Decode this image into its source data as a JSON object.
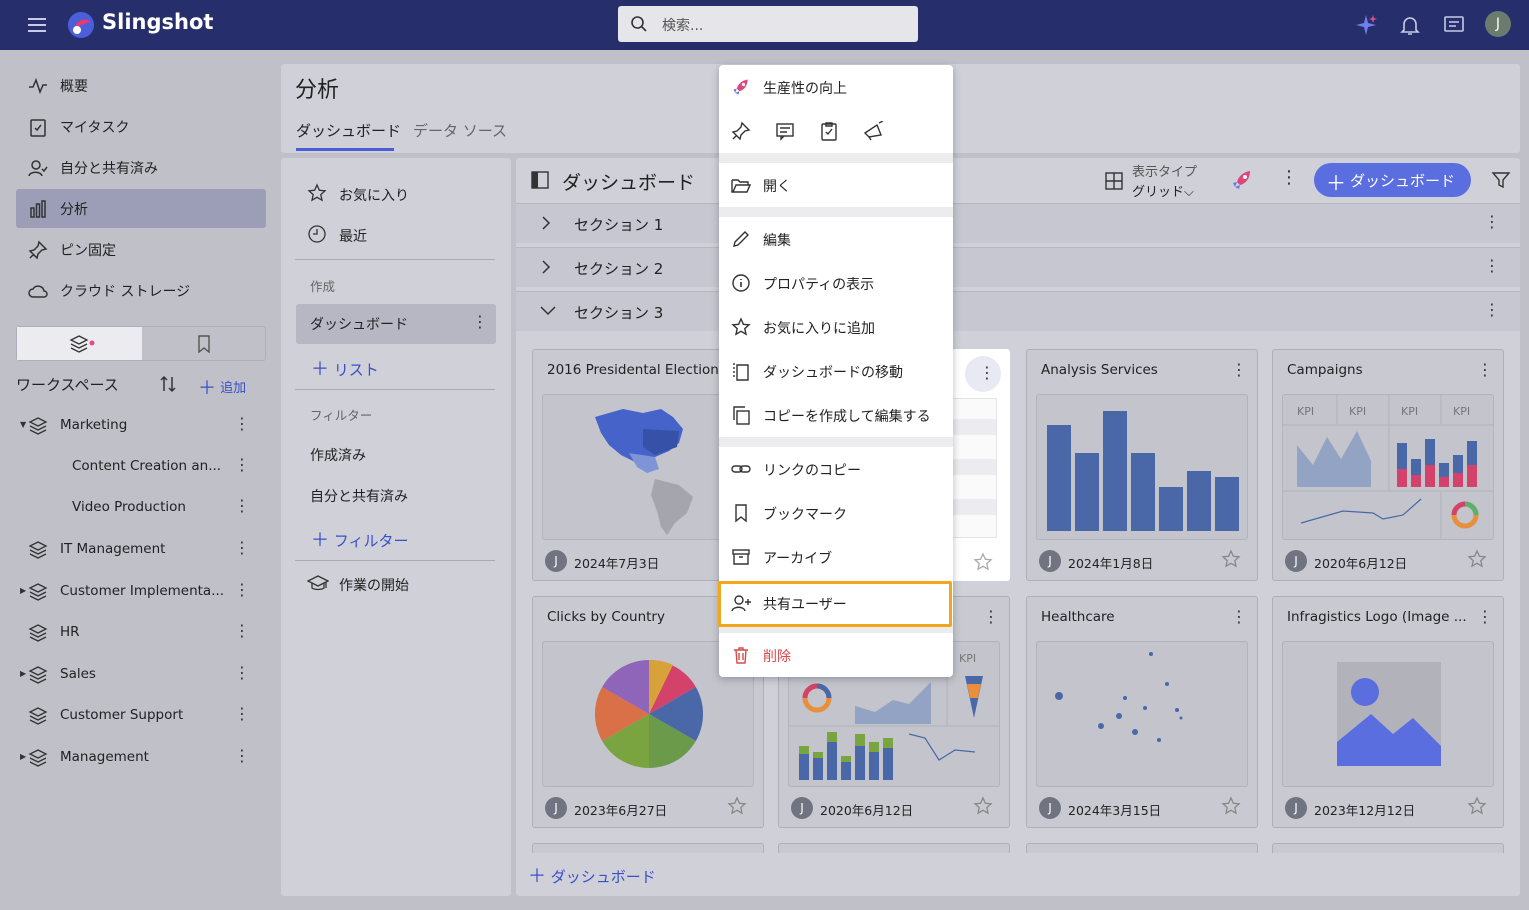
{
  "app": {
    "brand": "Slingshot"
  },
  "search": {
    "placeholder": "検索..."
  },
  "nav": {
    "items": [
      {
        "label": "概要"
      },
      {
        "label": "マイタスク"
      },
      {
        "label": "自分と共有済み"
      },
      {
        "label": "分析"
      },
      {
        "label": "ピン固定"
      },
      {
        "label": "クラウド ストレージ"
      }
    ]
  },
  "workspaces": {
    "title": "ワークスペース",
    "add_label": "追加",
    "items": [
      {
        "label": "Marketing"
      },
      {
        "label": "Content Creation an..."
      },
      {
        "label": "Video Production"
      },
      {
        "label": "IT Management"
      },
      {
        "label": "Customer Implementa..."
      },
      {
        "label": "HR"
      },
      {
        "label": "Sales"
      },
      {
        "label": "Customer Support"
      },
      {
        "label": "Management"
      }
    ]
  },
  "page": {
    "title": "分析",
    "tabs": [
      {
        "label": "ダッシュボード"
      },
      {
        "label": "データ ソース"
      }
    ]
  },
  "subnav": {
    "favorites": "お気に入り",
    "recent": "最近",
    "created_section": "作成",
    "dashboards": "ダッシュボード",
    "add_list": "リスト",
    "filters_section": "フィルター",
    "filter_created": "作成済み",
    "filter_shared": "自分と共有済み",
    "add_filter": "フィルター",
    "get_started": "作業の開始"
  },
  "content": {
    "title": "ダッシュボード",
    "view_type_label": "表示タイプ",
    "view_type_value": "グリッド",
    "add_dashboard": "ダッシュボード",
    "sections": [
      {
        "label": "セクション 1"
      },
      {
        "label": "セクション 2"
      },
      {
        "label": "セクション 3"
      }
    ],
    "add_dashboard_bottom": "ダッシュボード",
    "cards": [
      {
        "title": "2016 Presidental Election",
        "date": "2024年7月3日"
      },
      {
        "title": "Analysis Services",
        "date": "2024年1月8日"
      },
      {
        "title": "Campaigns",
        "date": "2020年6月12日"
      },
      {
        "title": "Clicks by Country",
        "date": "2023年6月27日"
      },
      {
        "title": "",
        "date": "2020年6月12日"
      },
      {
        "title": "Healthcare",
        "date": "2024年3月15日"
      },
      {
        "title": "Infragistics Logo (Image ...",
        "date": "2023年12月12日"
      }
    ],
    "avatar_initial": "J",
    "kpi_label": "KPI"
  },
  "menu": {
    "header": "生産性の向上",
    "open": "開く",
    "edit": "編集",
    "properties": "プロパティの表示",
    "favorite": "お気に入りに追加",
    "move": "ダッシュボードの移動",
    "copy_edit": "コピーを作成して編集する",
    "copy_link": "リンクのコピー",
    "bookmark": "ブックマーク",
    "archive": "アーカイブ",
    "shared_users": "共有ユーザー",
    "delete": "削除"
  },
  "user": {
    "initial": "J"
  },
  "colors": {
    "topbar": "#262f6b",
    "accent": "#5b6ee0",
    "highlight": "#f3a51c",
    "chart_blue": "#4a68a8"
  }
}
